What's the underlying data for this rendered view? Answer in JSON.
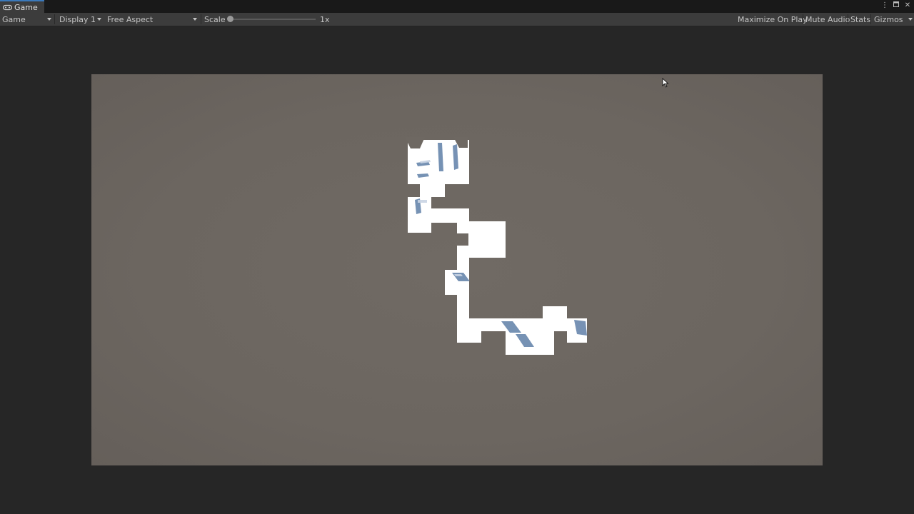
{
  "window": {
    "tab_title": "Game",
    "tab_icon": "gamepad-icon",
    "menu_icon": "kebab-menu-icon",
    "maximize_icon": "maximize-icon",
    "close_icon": "close-icon"
  },
  "toolbar": {
    "view_mode": "Game",
    "display": "Display 1",
    "aspect": "Free Aspect",
    "scale_label": "Scale",
    "scale_value": "1x",
    "scale_fraction": 0.0,
    "maximize_on_play": "Maximize On Play",
    "mute_audio": "Mute Audio",
    "stats": "Stats",
    "gizmos": "Gizmos"
  },
  "scene": {
    "background_color": "#6e6862",
    "floor_color": "#ffffff",
    "wall_accent_color": "#5f7fa8"
  }
}
